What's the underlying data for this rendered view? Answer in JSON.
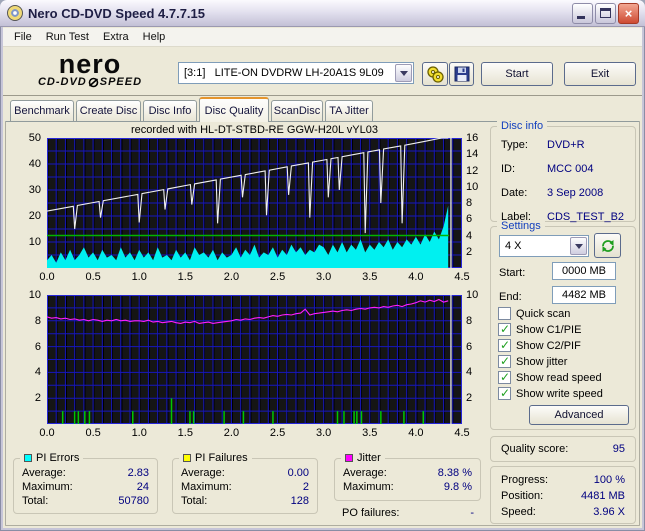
{
  "window": {
    "title": "Nero CD-DVD Speed 4.7.7.15"
  },
  "menu": {
    "items": [
      "File",
      "Run Test",
      "Extra",
      "Help"
    ]
  },
  "logo": {
    "line1": "nero",
    "line2a": "CD-DVD",
    "line2b": "SPEED"
  },
  "toolbar": {
    "drive": "[3:1]   LITE-ON DVDRW LH-20A1S 9L09",
    "start": "Start",
    "exit": "Exit"
  },
  "tabs": {
    "items": [
      "Benchmark",
      "Create Disc",
      "Disc Info",
      "Disc Quality",
      "ScanDisc",
      "TA Jitter"
    ],
    "active_index": 3
  },
  "chart_header": "recorded with HL-DT-STBD-RE  GGW-H20L  vYL03",
  "disc_info": {
    "legend": "Disc info",
    "rows": [
      {
        "label": "Type:",
        "value": "DVD+R"
      },
      {
        "label": "ID:",
        "value": "MCC 004"
      },
      {
        "label": "Date:",
        "value": "3 Sep 2008"
      },
      {
        "label": "Label:",
        "value": "CDS_TEST_B2"
      }
    ]
  },
  "settings": {
    "legend": "Settings",
    "speed": "4 X",
    "start_label": "Start:",
    "start_value": "0000 MB",
    "end_label": "End:",
    "end_value": "4482 MB",
    "checkboxes": [
      {
        "label": "Quick scan",
        "checked": false
      },
      {
        "label": "Show C1/PIE",
        "checked": true
      },
      {
        "label": "Show C2/PIF",
        "checked": true
      },
      {
        "label": "Show jitter",
        "checked": true
      },
      {
        "label": "Show read speed",
        "checked": true
      },
      {
        "label": "Show write speed",
        "checked": true
      }
    ],
    "advanced": "Advanced"
  },
  "quality": {
    "label": "Quality score:",
    "value": "95"
  },
  "progress": {
    "rows": [
      {
        "label": "Progress:",
        "value": "100 %"
      },
      {
        "label": "Position:",
        "value": "4481 MB"
      },
      {
        "label": "Speed:",
        "value": "3.96 X"
      }
    ]
  },
  "stats": {
    "pi_errors": {
      "legend": "PI Errors",
      "color": "#00FFFF",
      "rows": [
        {
          "label": "Average:",
          "value": "2.83"
        },
        {
          "label": "Maximum:",
          "value": "24"
        },
        {
          "label": "Total:",
          "value": "50780"
        }
      ]
    },
    "pi_failures": {
      "legend": "PI Failures",
      "color": "#FFFF00",
      "rows": [
        {
          "label": "Average:",
          "value": "0.00"
        },
        {
          "label": "Maximum:",
          "value": "2"
        },
        {
          "label": "Total:",
          "value": "128"
        }
      ]
    },
    "jitter": {
      "legend": "Jitter",
      "color": "#FF00FF",
      "rows": [
        {
          "label": "Average:",
          "value": "8.38 %"
        },
        {
          "label": "Maximum:",
          "value": "9.8 %"
        }
      ]
    },
    "po_failures": {
      "label": "PO failures:",
      "value": "-"
    }
  },
  "chart_data": [
    {
      "type": "area",
      "title": "recorded with HL-DT-STBD-RE  GGW-H20L  vYL03",
      "x_range": [
        0,
        4.5
      ],
      "x_ticks": [
        "0.0",
        "0.5",
        "1.0",
        "1.5",
        "2.0",
        "2.5",
        "3.0",
        "3.5",
        "4.0",
        "4.5"
      ],
      "x_grid": 0.1,
      "y_left": {
        "max": 50,
        "ticks": [
          10,
          20,
          30,
          40,
          50
        ],
        "grid": 5
      },
      "y_right": {
        "max": 16,
        "ticks": [
          2,
          4,
          6,
          8,
          10,
          12,
          14,
          16
        ]
      },
      "marker_x": 4.38,
      "series": [
        {
          "name": "PI Errors",
          "kind": "area",
          "axis": "left",
          "color": "#00F0F0",
          "x_start": 0,
          "x_step": 0.05,
          "values": [
            3,
            5,
            2,
            6,
            3,
            7,
            3,
            5,
            8,
            4,
            6,
            3,
            7,
            4,
            5,
            3,
            8,
            4,
            6,
            3,
            7,
            4,
            6,
            3,
            8,
            4,
            5,
            3,
            7,
            4,
            6,
            3,
            8,
            5,
            6,
            4,
            7,
            3,
            6,
            4,
            5,
            8,
            4,
            7,
            5,
            9,
            4,
            6,
            5,
            8,
            4,
            7,
            5,
            9,
            6,
            8,
            5,
            7,
            6,
            9,
            8,
            5,
            9,
            6,
            10,
            6,
            9,
            7,
            11,
            6,
            9,
            7,
            10,
            8,
            11,
            7,
            10,
            8,
            11,
            9,
            12,
            9,
            13,
            10,
            14,
            11,
            16,
            24
          ]
        },
        {
          "name": "Write speed",
          "kind": "hline",
          "axis": "right",
          "color": "#00B400",
          "value": 4,
          "x_end": 4.36
        },
        {
          "name": "Read speed",
          "kind": "line",
          "axis": "right",
          "color": "#F0F0F0",
          "points": [
            [
              0,
              7.0
            ],
            [
              0.285,
              7.6
            ],
            [
              0.3,
              4.8
            ],
            [
              0.33,
              7.69
            ],
            [
              0.565,
              8.18
            ],
            [
              0.58,
              6.2
            ],
            [
              0.61,
              8.28
            ],
            [
              0.985,
              9.06
            ],
            [
              1.0,
              5.6
            ],
            [
              1.03,
              9.16
            ],
            [
              1.265,
              9.65
            ],
            [
              1.28,
              7.2
            ],
            [
              1.31,
              9.74
            ],
            [
              1.555,
              10.26
            ],
            [
              1.57,
              7.8
            ],
            [
              1.6,
              10.35
            ],
            [
              1.835,
              10.84
            ],
            [
              1.85,
              5.5
            ],
            [
              1.88,
              10.94
            ],
            [
              2.105,
              11.41
            ],
            [
              2.12,
              8.7
            ],
            [
              2.15,
              11.5
            ],
            [
              2.365,
              11.95
            ],
            [
              2.38,
              6.5
            ],
            [
              2.41,
              12.04
            ],
            [
              2.605,
              12.45
            ],
            [
              2.62,
              9.0
            ],
            [
              2.65,
              12.55
            ],
            [
              2.835,
              12.93
            ],
            [
              2.85,
              6.2
            ],
            [
              2.88,
              13.03
            ],
            [
              3.035,
              13.35
            ],
            [
              3.05,
              8.7
            ],
            [
              3.08,
              13.45
            ],
            [
              3.155,
              13.6
            ],
            [
              3.17,
              9.6
            ],
            [
              3.2,
              13.7
            ],
            [
              3.435,
              14.19
            ],
            [
              3.45,
              4.3
            ],
            [
              3.48,
              14.28
            ],
            [
              3.605,
              14.55
            ],
            [
              3.62,
              8.0
            ],
            [
              3.65,
              14.64
            ],
            [
              3.835,
              15.03
            ],
            [
              3.85,
              5.5
            ],
            [
              3.88,
              15.12
            ],
            [
              4.1,
              15.6
            ],
            [
              4.28,
              16.0
            ],
            [
              4.35,
              16.0
            ]
          ]
        }
      ]
    },
    {
      "type": "line",
      "x_range": [
        0,
        4.5
      ],
      "x_ticks": [
        "0.0",
        "0.5",
        "1.0",
        "1.5",
        "2.0",
        "2.5",
        "3.0",
        "3.5",
        "4.0",
        "4.5"
      ],
      "x_grid": 0.1,
      "y_left": {
        "max": 10,
        "ticks": [
          2,
          4,
          6,
          8,
          10
        ],
        "grid": 1
      },
      "y_right": {
        "max": 10,
        "ticks": [
          2,
          4,
          6,
          8,
          10
        ]
      },
      "marker_x": 4.38,
      "series": [
        {
          "name": "PI Failures",
          "kind": "spikes",
          "axis": "left",
          "color": "#00C800",
          "points": [
            [
              0.17,
              1
            ],
            [
              0.3,
              1
            ],
            [
              0.34,
              1
            ],
            [
              0.41,
              1
            ],
            [
              0.46,
              1
            ],
            [
              0.93,
              1
            ],
            [
              1.35,
              2
            ],
            [
              1.55,
              1
            ],
            [
              1.59,
              1
            ],
            [
              1.92,
              1
            ],
            [
              2.13,
              1
            ],
            [
              2.45,
              1
            ],
            [
              3.15,
              1
            ],
            [
              3.22,
              1
            ],
            [
              3.33,
              1
            ],
            [
              3.36,
              1
            ],
            [
              3.41,
              1
            ],
            [
              3.62,
              1
            ],
            [
              3.87,
              1
            ],
            [
              4.08,
              1
            ]
          ]
        },
        {
          "name": "Jitter",
          "kind": "line",
          "axis": "left",
          "color": "#FF1EFF",
          "x_start": 0,
          "x_step": 0.05,
          "values": [
            8.3,
            8.2,
            8.25,
            8.15,
            8.2,
            8.1,
            8.15,
            8.05,
            8.1,
            8.0,
            8.1,
            8.05,
            7.95,
            8.05,
            8.0,
            8.1,
            8.0,
            8.05,
            7.95,
            8.0,
            8.0,
            7.95,
            8.05,
            7.9,
            7.95,
            7.85,
            7.9,
            7.95,
            7.85,
            7.8,
            7.9,
            7.85,
            7.95,
            7.8,
            7.85,
            7.9,
            7.8,
            7.85,
            7.9,
            7.95,
            8.0,
            8.1,
            8.05,
            8.15,
            8.1,
            8.2,
            8.25,
            8.2,
            8.3,
            8.4,
            8.35,
            8.45,
            8.5,
            8.45,
            8.55,
            8.6,
            8.9,
            8.45,
            8.55,
            8.6,
            8.65,
            8.7,
            8.75,
            8.7,
            8.8,
            8.85,
            8.8,
            8.9,
            8.95,
            8.9,
            9.0,
            9.05,
            9.0,
            9.1,
            9.05,
            9.15,
            9.2,
            9.1,
            9.25,
            9.3,
            9.4,
            9.55,
            9.45,
            9.6,
            9.5,
            9.65,
            9.45,
            9.55
          ]
        }
      ]
    }
  ]
}
